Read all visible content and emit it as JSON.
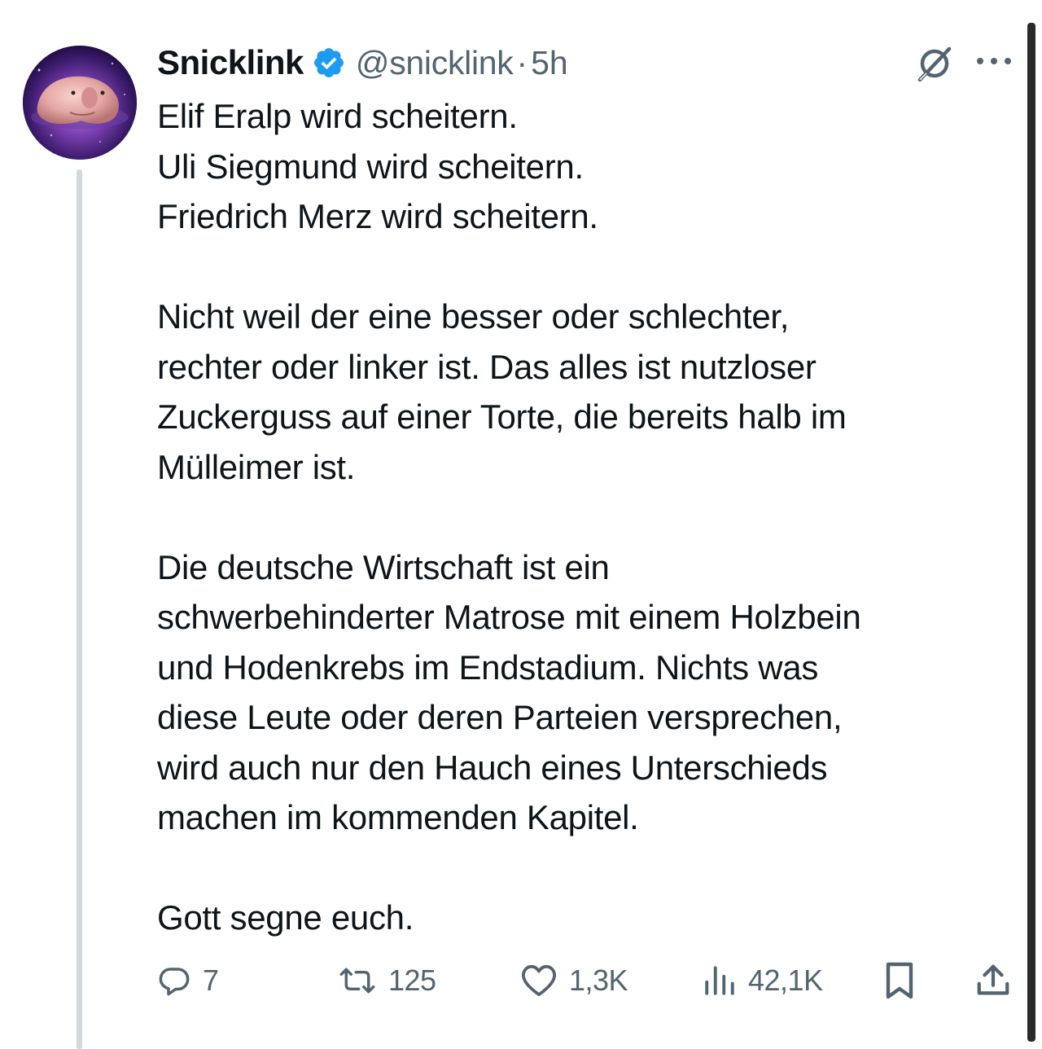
{
  "tweet": {
    "display_name": "Snicklink",
    "handle": "@snicklink",
    "separator": "·",
    "time": "5h",
    "paragraphs": [
      [
        "Elif Eralp wird scheitern.",
        "Uli Siegmund wird scheitern.",
        "Friedrich Merz wird scheitern."
      ],
      [
        "Nicht weil der eine besser oder schlechter,",
        "rechter oder linker ist. Das alles ist nutzloser",
        "Zuckerguss auf einer Torte, die bereits halb im",
        "Mülleimer ist."
      ],
      [
        "Die deutsche Wirtschaft ist ein",
        "schwerbehinderter Matrose mit einem Holzbein",
        "und Hodenkrebs im Endstadium. Nichts was",
        "diese Leute oder deren Parteien versprechen,",
        "wird auch nur den Hauch eines Unterschieds",
        "machen im kommenden Kapitel."
      ],
      [
        "Gott segne euch."
      ]
    ],
    "actions": {
      "replies": "7",
      "reposts": "125",
      "likes": "1,3K",
      "views": "42,1K"
    }
  },
  "icons": {
    "verified": "verified-badge-icon",
    "grok": "grok-icon",
    "more": "more-icon",
    "reply": "reply-icon",
    "repost": "repost-icon",
    "like": "like-icon",
    "views": "views-icon",
    "bookmark": "bookmark-icon",
    "share": "share-icon"
  },
  "colors": {
    "text": "#0f1419",
    "secondary": "#536471",
    "verified": "#1d9bf0",
    "thread_line": "#cfd9de"
  }
}
